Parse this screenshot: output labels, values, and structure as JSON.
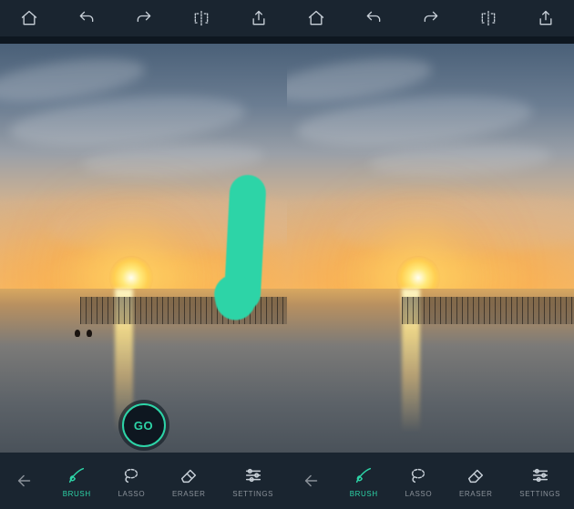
{
  "accent_color": "#2dd4a7",
  "panes": [
    {
      "id": "left",
      "has_brush_mark": true,
      "go_label": "GO",
      "top_icons": [
        "home-icon",
        "undo-icon",
        "redo-icon",
        "flip-icon",
        "share-icon"
      ],
      "tools": {
        "back": {
          "label": ""
        },
        "brush": {
          "label": "BRUSH",
          "active": true
        },
        "lasso": {
          "label": "LASSO",
          "active": false
        },
        "eraser": {
          "label": "ERASER",
          "active": false
        },
        "settings": {
          "label": "SETTINGS",
          "active": false
        }
      }
    },
    {
      "id": "right",
      "has_brush_mark": false,
      "go_label": "",
      "top_icons": [
        "home-icon",
        "undo-icon",
        "redo-icon",
        "flip-icon",
        "share-icon"
      ],
      "tools": {
        "back": {
          "label": ""
        },
        "brush": {
          "label": "BRUSH",
          "active": true
        },
        "lasso": {
          "label": "LASSO",
          "active": false
        },
        "eraser": {
          "label": "ERASER",
          "active": false
        },
        "settings": {
          "label": "SETTINGS",
          "active": false
        }
      }
    }
  ]
}
